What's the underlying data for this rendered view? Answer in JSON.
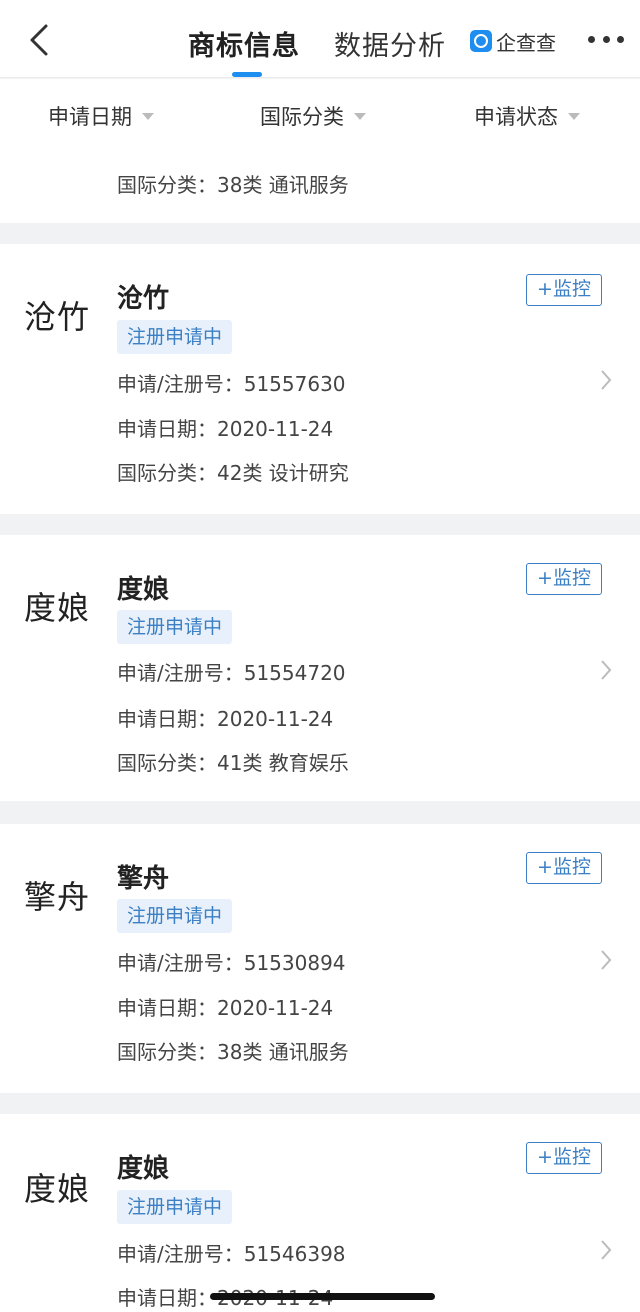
{
  "header": {
    "tabs": [
      {
        "label": "商标信息",
        "active": true
      },
      {
        "label": "数据分析",
        "active": false
      }
    ],
    "brand": "企查查",
    "icons": {
      "back": "chevron-left-icon",
      "more": "more-dots-icon"
    }
  },
  "filters": [
    {
      "label": "申请日期"
    },
    {
      "label": "国际分类"
    },
    {
      "label": "申请状态"
    }
  ],
  "partial_row": {
    "line": "国际分类：38类 通讯服务"
  },
  "monitor_label": "+监控",
  "colors": {
    "accent": "#1e8df0",
    "status_text": "#3b7fc4",
    "status_bg": "#e8f1fb"
  },
  "trademarks": [
    {
      "logo_text": "沧竹",
      "name": "沧竹",
      "status": "注册申请中",
      "reg_line": "申请/注册号：51557630",
      "date_line": "申请日期：2020-11-24",
      "class_line": "国际分类：42类 设计研究"
    },
    {
      "logo_text": "度娘",
      "name": "度娘",
      "status": "注册申请中",
      "reg_line": "申请/注册号：51554720",
      "date_line": "申请日期：2020-11-24",
      "class_line": "国际分类：41类 教育娱乐"
    },
    {
      "logo_text": "擎舟",
      "name": "擎舟",
      "status": "注册申请中",
      "reg_line": "申请/注册号：51530894",
      "date_line": "申请日期：2020-11-24",
      "class_line": "国际分类：38类 通讯服务"
    },
    {
      "logo_text": "度娘",
      "name": "度娘",
      "status": "注册申请中",
      "reg_line": "申请/注册号：51546398",
      "date_line": "申请日期：2020-11-24",
      "class_line": ""
    }
  ]
}
